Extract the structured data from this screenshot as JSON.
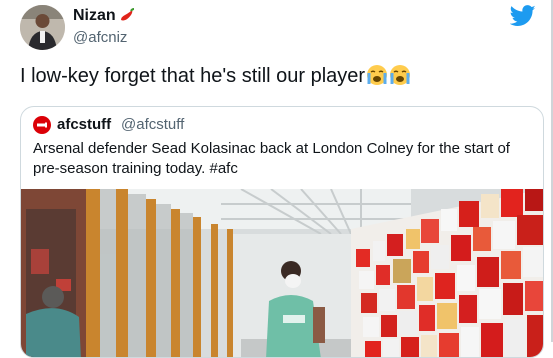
{
  "tweet": {
    "author_name": "Nizan",
    "author_handle": "@afcniz",
    "text": "I low-key forget that he's still our player",
    "emojis": [
      "crying-face-emoji",
      "crying-face-emoji"
    ]
  },
  "quoted_tweet": {
    "author_name": "afcstuff",
    "author_handle": "@afcstuff",
    "text": "Arsenal defender Sead Kolasinac back at London Colney for the start of pre-season training today. #afc"
  },
  "icons": {
    "brand": "twitter-bird-icon",
    "name_emoji": "chili-pepper-emoji",
    "quote_logo": "arsenal-crest-icon"
  },
  "colors": {
    "brand_blue": "#1d9bf0",
    "text": "#0f1419",
    "secondary_text": "#536471",
    "border": "#cfd9de",
    "arsenal_red": "#db0007"
  }
}
